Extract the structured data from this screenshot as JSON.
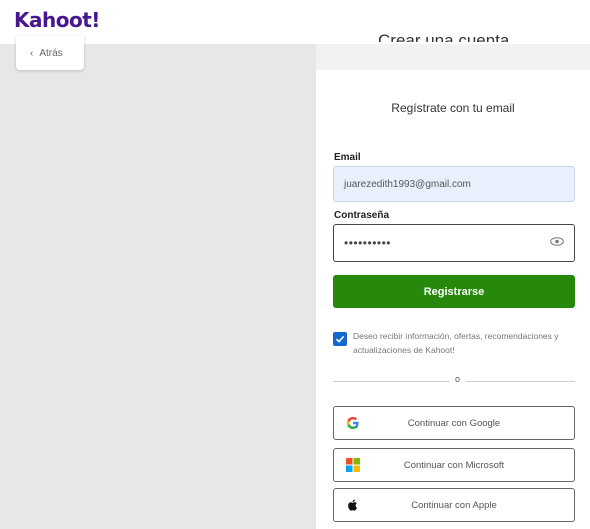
{
  "brand": {
    "logo": "Kahoot!",
    "color": "#46178f"
  },
  "header": {
    "title": "Crear una cuenta",
    "back_label": "Atrás"
  },
  "card": {
    "title": "Regístrate con tu email",
    "email_label": "Email",
    "email_value": "juarezedith1993@gmail.com",
    "password_label": "Contraseña",
    "password_value": "••••••••••",
    "submit_label": "Registrarse",
    "submit_color": "#26890c",
    "consent_text": "Deseo recibir información, ofertas, recomendaciones y actualizaciones de Kahoot!",
    "consent_checked": true,
    "divider_text": "o",
    "social": [
      {
        "label": "Continuar con Google",
        "icon": "google-icon"
      },
      {
        "label": "Continuar con Microsoft",
        "icon": "microsoft-icon"
      },
      {
        "label": "Continuar con Apple",
        "icon": "apple-icon"
      }
    ]
  }
}
